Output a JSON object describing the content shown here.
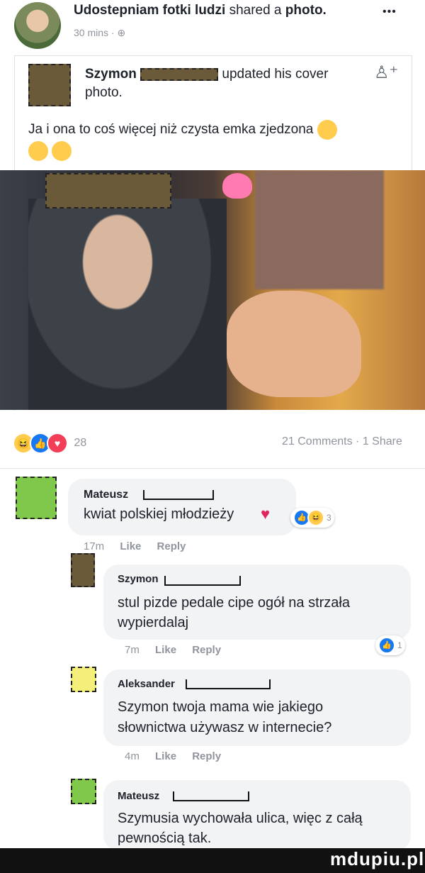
{
  "post": {
    "page_name": "Udostepniam fotki ludzi",
    "shared_text": "shared a",
    "object": "photo.",
    "time": "30 mins",
    "more": "•••"
  },
  "shared": {
    "author": "Szymon",
    "action": "updated his cover",
    "action2": "photo.",
    "caption": "Ja i ona to coś więcej niż czysta emka zjedzona"
  },
  "stats": {
    "reaction_count": "28",
    "comments": "21 Comments",
    "shares": "1 Share"
  },
  "comments": [
    {
      "author": "Mateusz",
      "text": "kwiat polskiej młodzieży",
      "time": "17m",
      "like": "Like",
      "reply": "Reply",
      "reactions": "3"
    },
    {
      "author": "Szymon",
      "text": "stul pizde pedale cipe ogół na strzała wypierdalaj",
      "time": "7m",
      "like": "Like",
      "reply": "Reply",
      "reactions": "1"
    },
    {
      "author": "Aleksander",
      "text": "Szymon twoja mama wie jakiego słownictwa używasz w internecie?",
      "time": "4m",
      "like": "Like",
      "reply": "Reply"
    },
    {
      "author": "Mateusz",
      "text": "Szymusia wychowała ulica, więc z całą pewnością tak."
    }
  ],
  "watermark": "mdupiu.pl",
  "colors": {
    "like_blue": "#1877f2",
    "love_red": "#f33e58",
    "haha_yellow": "#ffcc4d",
    "watermark_bg": "#111111"
  }
}
